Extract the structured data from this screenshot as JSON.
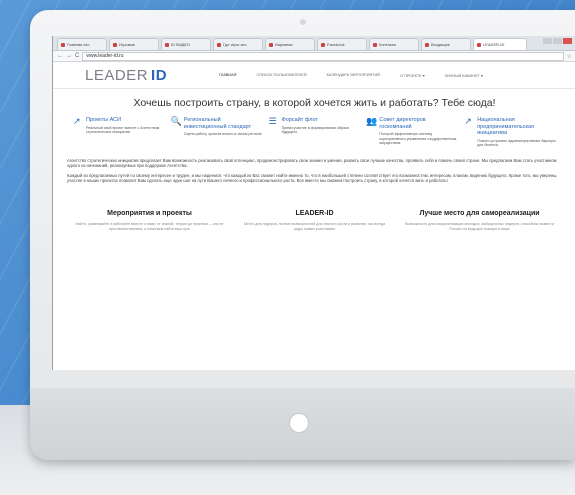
{
  "browser": {
    "tabs": [
      "Главная ато",
      "Игровые",
      "ID ВИДЕО",
      "Где игры ато",
      "Ищемежс",
      "Facebook",
      "Контакты",
      "Входящие",
      "LEADER-ID"
    ],
    "url": "www.leader-id.ru"
  },
  "site": {
    "logo_prefix": "LEADER",
    "logo_suffix": "ID",
    "menu": [
      "ГЛАВНАЯ",
      "СПИСОК ПОЛЬЗОВАТЕЛЕЙ",
      "КАЛЕНДАРЬ МЕРОПРИЯТИЙ",
      "О ПРОЕКТЕ ▾",
      "ЛИЧНЫЙ КАБИНЕТ ▾"
    ],
    "headline": "Хочешь построить страну, в которой хочется жить и работать? Тебе сюда!",
    "features": [
      {
        "icon": "↗",
        "title": "Проекты АСИ",
        "desc": "Реальный свой проект вместе с Агентством стратегических инициатив"
      },
      {
        "icon": "🔍",
        "title": "Региональный инвестиционный стандарт",
        "desc": "Оцени работу органов власти в твоем регионе"
      },
      {
        "icon": "☰",
        "title": "Форсайт флот",
        "desc": "Прими участие в формировании образа будущего"
      },
      {
        "icon": "👥",
        "title": "Совет директоров госкомпаний",
        "desc": "Построй эффективную систему корпоративного управления государственным имуществом"
      },
      {
        "icon": "↗",
        "title": "Национальная предпринимательская инициатива",
        "desc": "Помоги устранить административные барьеры для бизнеса"
      }
    ],
    "para1": "Агентство стратегических инициатив предлагает Вам возможность реализовать свой потенциал, продемонстрировать свои знания и умения, развить свои лучшие качества, проявить себя и помочь своей стране. Мы предлагаем Вам стать участником одного из начинаний, реализуемых при поддержке Агентства.",
    "para2": "Каждый из предлагаемых путей по своему интересен и труден, и мы надеемся, что каждый из Вас сможет найти именно то, что в наибольшей степени соответствует его возможностям, интересам, планам, видению будущего. Кроме того, мы уверены, участие в наших проектах позволит Вам сделать еще один шаг на пути Вашего личного и профессионального роста. Все вместе мы сможем построить страну, в которой хочется жить и работать!",
    "columns": [
      {
        "title": "Мероприятия и проекты",
        "desc": "Найти, сравнивайте и работайте вместе с нами: от знаний, теории до практики — мы не противопоставляем, а помогаем найти ваш путь"
      },
      {
        "title": "LEADER-ID",
        "desc": "Место для лидеров, полное возможностей для личного роста и развития, мы всегда рады новым участникам"
      },
      {
        "title": "Лучше место для самореализации",
        "desc": "Возможность для самореализации молодых, амбициозных лидеров, способных вывести Россию на ведущие позиции в мире"
      }
    ]
  },
  "colors": {
    "accent": "#2a66b5",
    "background": "#4d8ed0"
  }
}
